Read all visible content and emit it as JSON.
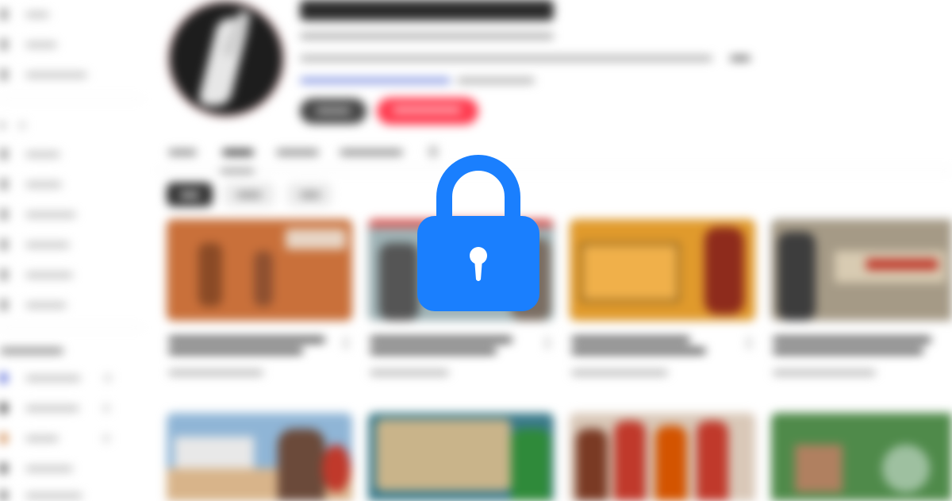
{
  "overlay": {
    "icon": "lock-icon",
    "color": "#1a7ffe"
  },
  "colors": {
    "subscribe": "#ff3b4f",
    "lock": "#1a7ffe"
  }
}
